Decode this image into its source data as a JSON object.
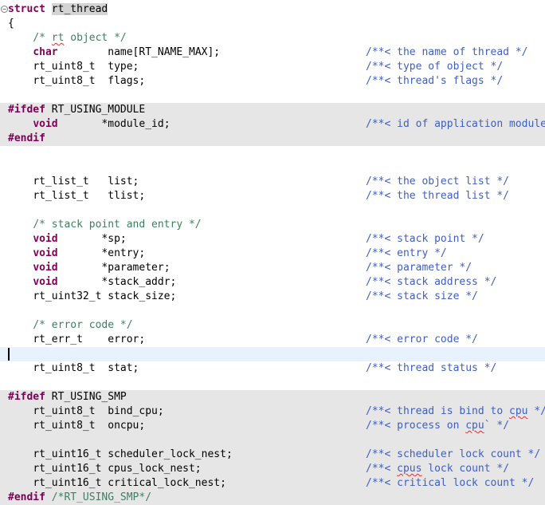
{
  "code": {
    "struct_kw": "struct",
    "struct_name": "rt_thread",
    "open_brace": "{",
    "c_obj": "/* rt object */",
    "char_kw": "char",
    "name_field": "name[RT_NAME_MAX];",
    "name_cmt": "/**< the name of thread */",
    "type_t1": "rt_uint8_t",
    "type_field": "type;",
    "type_cmt": "/**< type of object */",
    "type_t2": "rt_uint8_t",
    "flags_field": "flags;",
    "flags_cmt": "/**< thread's flags */",
    "ifdef1": "#ifdef",
    "ifdef1_macro": "RT_USING_MODULE",
    "void1": "void",
    "module_field": "*module_id;",
    "module_cmt": "/**< id of application module */",
    "endif1": "#endif",
    "list_t1": "rt_list_t",
    "list_field": "list;",
    "list_cmt": "/**< the object list */",
    "list_t2": "rt_list_t",
    "tlist_field": "tlist;",
    "tlist_cmt": "/**< the thread list */",
    "c_stack": "/* stack point and entry */",
    "void2": "void",
    "sp_field": "*sp;",
    "sp_cmt": "/**< stack point */",
    "void3": "void",
    "entry_field": "*entry;",
    "entry_cmt": "/**< entry */",
    "void4": "void",
    "param_field": "*parameter;",
    "param_cmt": "/**< parameter */",
    "void5": "void",
    "saddr_field": "*stack_addr;",
    "saddr_cmt": "/**< stack address */",
    "u32_t": "rt_uint32_t",
    "ssize_field": "stack_size;",
    "ssize_cmt": "/**< stack size */",
    "c_err": "/* error code */",
    "err_t": "rt_err_t",
    "err_field": "error;",
    "err_cmt": "/**< error code */",
    "stat_t": "rt_uint8_t",
    "stat_field": "stat;",
    "stat_cmt": "/**< thread status */",
    "ifdef2": "#ifdef",
    "ifdef2_macro": "RT_USING_SMP",
    "bind_t": "rt_uint8_t",
    "bind_field": "bind_cpu;",
    "bind_cmt_a": "/**< thread is bind to ",
    "bind_cmt_b": "cpu",
    "bind_cmt_c": " */",
    "oncpu_t": "rt_uint8_t",
    "oncpu_field": "oncpu;",
    "oncpu_cmt_a": "/**< process on ",
    "oncpu_cmt_b": "cpu",
    "oncpu_cmt_c": "` */",
    "sln_t": "rt_uint16_t",
    "sln_field": "scheduler_lock_nest;",
    "sln_cmt": "/**< scheduler lock count */",
    "cln_t": "rt_uint16_t",
    "cln_field": "cpus_lock_nest;",
    "cln_cmt_a": "/**< ",
    "cln_cmt_b": "cpus",
    "cln_cmt_c": " lock count */",
    "crit_t": "rt_uint16_t",
    "crit_field": "critical_lock_nest;",
    "crit_cmt": "/**< critical lock count */",
    "endif2": "#endif",
    "endif2_cmt": "/*RT_USING_SMP*/"
  },
  "colors": {
    "keyword": "#7f0055",
    "comment": "#3f7f5f",
    "doc_comment": "#3f5fbf",
    "inactive_block": "#e6e6e6",
    "current_line": "#e8f2fe"
  }
}
